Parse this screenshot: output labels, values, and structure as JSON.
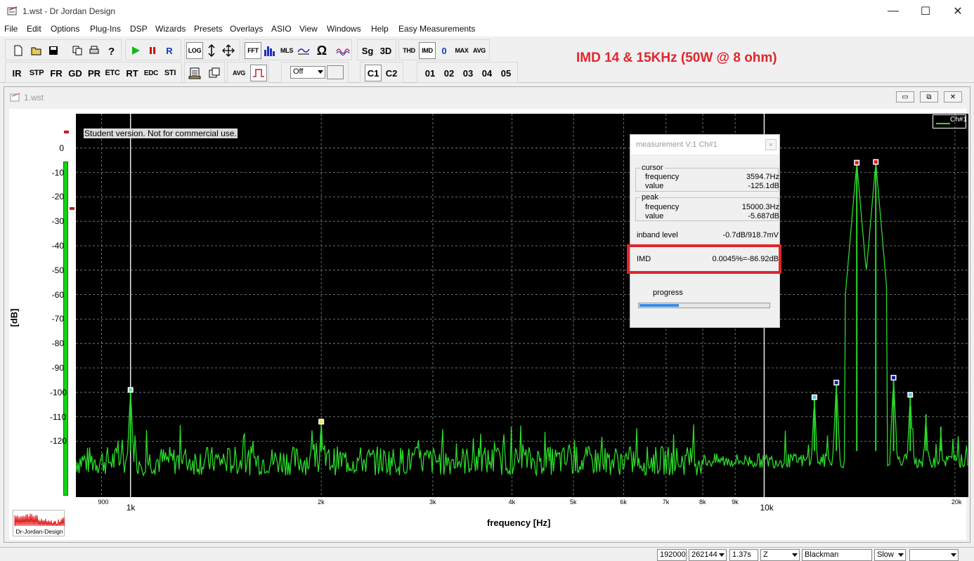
{
  "window": {
    "title": "1.wst - Dr Jordan Design",
    "min": "—",
    "max": "☐",
    "close": "✕"
  },
  "menu": [
    "File",
    "Edit",
    "Options",
    "Plug-Ins",
    "DSP",
    "Wizards",
    "Presets",
    "Overlays",
    "ASIO",
    "View",
    "Windows",
    "Help",
    "Easy Measurements"
  ],
  "toolbar": {
    "row1_labels": {
      "log": "LOG",
      "fft": "FFT",
      "mls": "MLS",
      "sg": "Sg",
      "three_d": "3D",
      "thd": "THD",
      "imd": "IMD",
      "zero": "0",
      "max": "MAX",
      "avg": "AVG",
      "rec": "R"
    },
    "row2_labels": {
      "ir": "IR",
      "stp": "STP",
      "fr": "FR",
      "gd": "GD",
      "pr": "PR",
      "etc": "ETC",
      "rt": "RT",
      "edc": "EDC",
      "sti": "STI",
      "avg": "AVG",
      "c1": "C1",
      "c2": "C2",
      "o1": "01",
      "o2": "02",
      "o3": "03",
      "o4": "04",
      "o5": "05"
    },
    "overlay_select": "Off"
  },
  "banner": "IMD 14 & 15KHz (50W @ 8 ohm)",
  "child_window": {
    "title": "1.wst",
    "min": "▭",
    "restore": "⧉",
    "close": "✕"
  },
  "plot": {
    "student_notice": "Student version. Not for commercial use.",
    "legend": "Ch#1",
    "logo_text": "Dr-Jordan-Design"
  },
  "measurement": {
    "title": "measurement V:1 Ch#1",
    "close": "×",
    "cursor": {
      "label": "cursor",
      "frequency_label": "frequency",
      "frequency": "3594.7Hz",
      "value_label": "value",
      "value": "-125.1dB"
    },
    "peak": {
      "label": "peak",
      "frequency_label": "frequency",
      "frequency": "15000.3Hz",
      "value_label": "value",
      "value": "-5.687dB"
    },
    "inband_label": "inband level",
    "inband": "-0.7dB/918.7mV",
    "imd_label": "IMD",
    "imd": "0.0045%=-86.92dB",
    "progress_label": "progress",
    "progress": 0.3
  },
  "statusbar": {
    "rate": "192000",
    "fft_size": "262144",
    "time": "1.37s",
    "z": "Z",
    "window_fn": "Blackman",
    "speed": "Slow",
    "blank": ""
  },
  "colors": {
    "trace": "#2bd92b",
    "banner": "#e0262c",
    "plot_bg": "#000000",
    "marker_red": "#d42020",
    "marker_blue": "#1a1aa8",
    "marker_cyan": "#5cc8e8",
    "marker_yellow": "#f0e070"
  },
  "chart_data": {
    "type": "line",
    "xlabel": "frequency [Hz]",
    "ylabel": "[dB]",
    "x_scale": "log",
    "xlim": [
      820,
      21000
    ],
    "ylim": [
      -140,
      10
    ],
    "y_ticks": [
      0,
      -10,
      -20,
      -30,
      -40,
      -50,
      -60,
      -70,
      -80,
      -90,
      -100,
      -110,
      -120
    ],
    "x_ticks": [
      {
        "value": 900,
        "label": "900",
        "major": false
      },
      {
        "value": 1000,
        "label": "1k",
        "major": true
      },
      {
        "value": 2000,
        "label": "2k",
        "major": false
      },
      {
        "value": 3000,
        "label": "3k",
        "major": false
      },
      {
        "value": 4000,
        "label": "4k",
        "major": false
      },
      {
        "value": 5000,
        "label": "5k",
        "major": false
      },
      {
        "value": 6000,
        "label": "6k",
        "major": false
      },
      {
        "value": 7000,
        "label": "7k",
        "major": false
      },
      {
        "value": 8000,
        "label": "8k",
        "major": false
      },
      {
        "value": 9000,
        "label": "9k",
        "major": false
      },
      {
        "value": 10000,
        "label": "10k",
        "major": true
      },
      {
        "value": 20000,
        "label": "20k",
        "major": false
      }
    ],
    "grid": true,
    "noise_floor_db": -128,
    "series": [
      {
        "name": "Ch#1",
        "peaks": [
          {
            "x": 1000,
            "y": -99
          },
          {
            "x": 2000,
            "y": -112
          },
          {
            "x": 12000,
            "y": -102
          },
          {
            "x": 13000,
            "y": -96
          },
          {
            "x": 14000,
            "y": -6
          },
          {
            "x": 15000,
            "y": -5.7
          },
          {
            "x": 16000,
            "y": -94
          },
          {
            "x": 17000,
            "y": -101
          },
          {
            "x": 18000,
            "y": -109
          },
          {
            "x": 19000,
            "y": -114
          }
        ]
      }
    ],
    "markers": [
      {
        "x": 1000,
        "y": -99,
        "color": "cyan-green"
      },
      {
        "x": 2000,
        "y": -112,
        "color": "yellow"
      },
      {
        "x": 12000,
        "y": -102,
        "color": "cyan"
      },
      {
        "x": 13000,
        "y": -96,
        "color": "blue"
      },
      {
        "x": 14000,
        "y": -6,
        "color": "red"
      },
      {
        "x": 15000,
        "y": -5.7,
        "color": "red"
      },
      {
        "x": 16000,
        "y": -94,
        "color": "blue"
      },
      {
        "x": 17000,
        "y": -101,
        "color": "cyan"
      }
    ],
    "cursor_lines": [
      1000,
      10000
    ]
  }
}
